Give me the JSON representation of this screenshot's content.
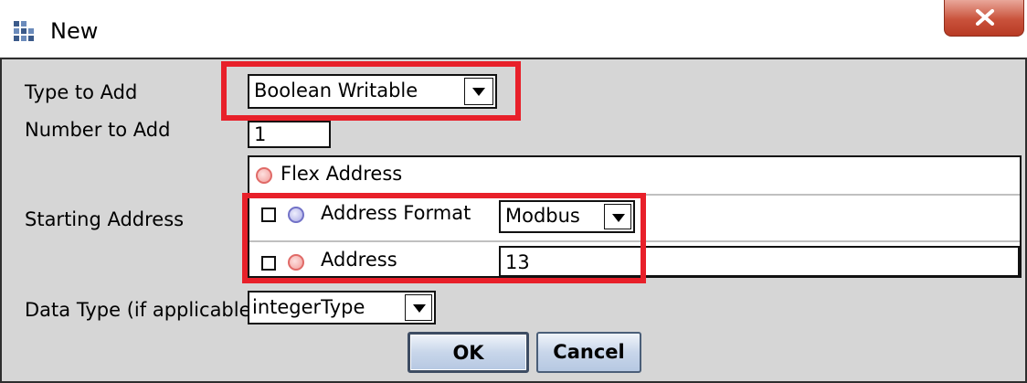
{
  "window": {
    "title": "New",
    "icon": "grid-icon",
    "close_icon": "close-icon"
  },
  "form": {
    "type_to_add": {
      "label": "Type to Add",
      "value": "Boolean Writable"
    },
    "number_to_add": {
      "label": "Number to Add",
      "value": "1"
    },
    "starting_address": {
      "label": "Starting Address",
      "flex_address_label": "Flex Address",
      "address_format": {
        "label": "Address Format",
        "value": "Modbus",
        "checked": false
      },
      "address": {
        "label": "Address",
        "value": "13",
        "checked": false
      }
    },
    "data_type": {
      "label": "Data Type (if applicable)",
      "value": "integerType"
    }
  },
  "buttons": {
    "ok": "OK",
    "cancel": "Cancel"
  },
  "highlight_color": "#e8202a"
}
